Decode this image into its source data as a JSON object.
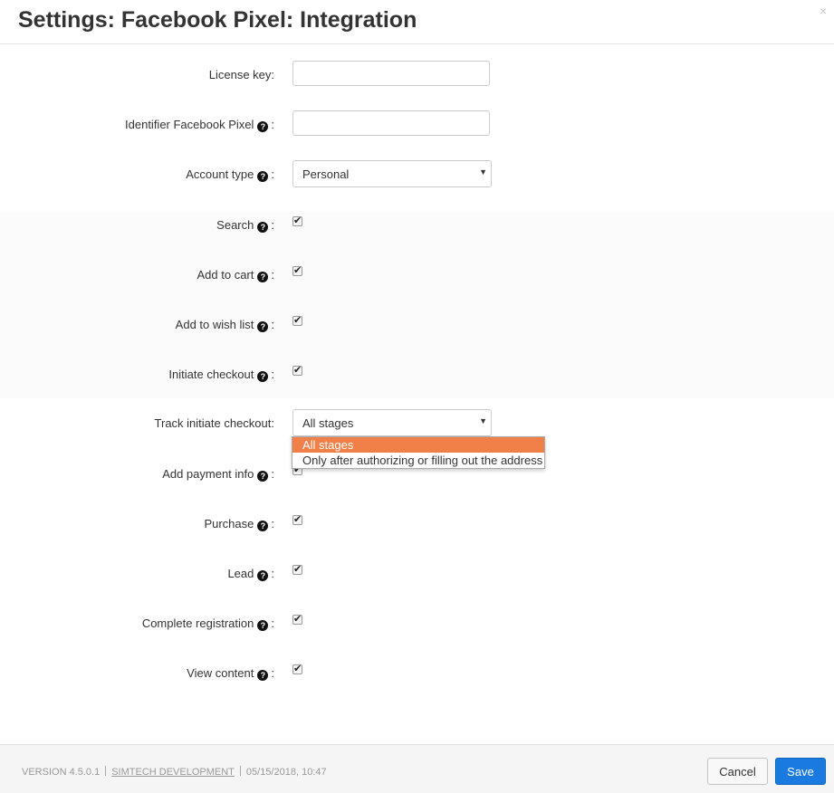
{
  "dialog": {
    "title": "Settings: Facebook Pixel: Integration",
    "close_glyph": "×"
  },
  "help_glyph": "?",
  "colon": ":",
  "fields": {
    "license_key": {
      "label": "License key:",
      "value": ""
    },
    "pixel_id": {
      "label": "Identifier Facebook Pixel",
      "value": ""
    },
    "account_type": {
      "label": "Account type",
      "value": "Personal"
    },
    "search": {
      "label": "Search",
      "checked": true
    },
    "add_to_cart": {
      "label": "Add to cart",
      "checked": true
    },
    "add_to_wishlist": {
      "label": "Add to wish list",
      "checked": true
    },
    "initiate_checkout": {
      "label": "Initiate checkout",
      "checked": true
    },
    "track_initiate_checkout": {
      "label": "Track initiate checkout:",
      "value": "All stages",
      "options": [
        "All stages",
        "Only after authorizing or filling out the address"
      ]
    },
    "add_payment_info": {
      "label": "Add payment info",
      "checked": true
    },
    "purchase": {
      "label": "Purchase",
      "checked": true
    },
    "lead": {
      "label": "Lead",
      "checked": true
    },
    "complete_registration": {
      "label": "Complete registration",
      "checked": true
    },
    "view_content": {
      "label": "View content",
      "checked": true
    }
  },
  "footer": {
    "version": "VERSION 4.5.0.1",
    "company": "SIMTECH DEVELOPMENT",
    "datetime": "05/15/2018, 10:47",
    "cancel_label": "Cancel",
    "save_label": "Save"
  },
  "colors": {
    "accent": "#1a7ae0",
    "dropdown_highlight": "#f07f48"
  },
  "icons": {
    "help": "question-circle-icon",
    "checkmark": "checkmark-icon",
    "caret": "caret-down-icon"
  }
}
